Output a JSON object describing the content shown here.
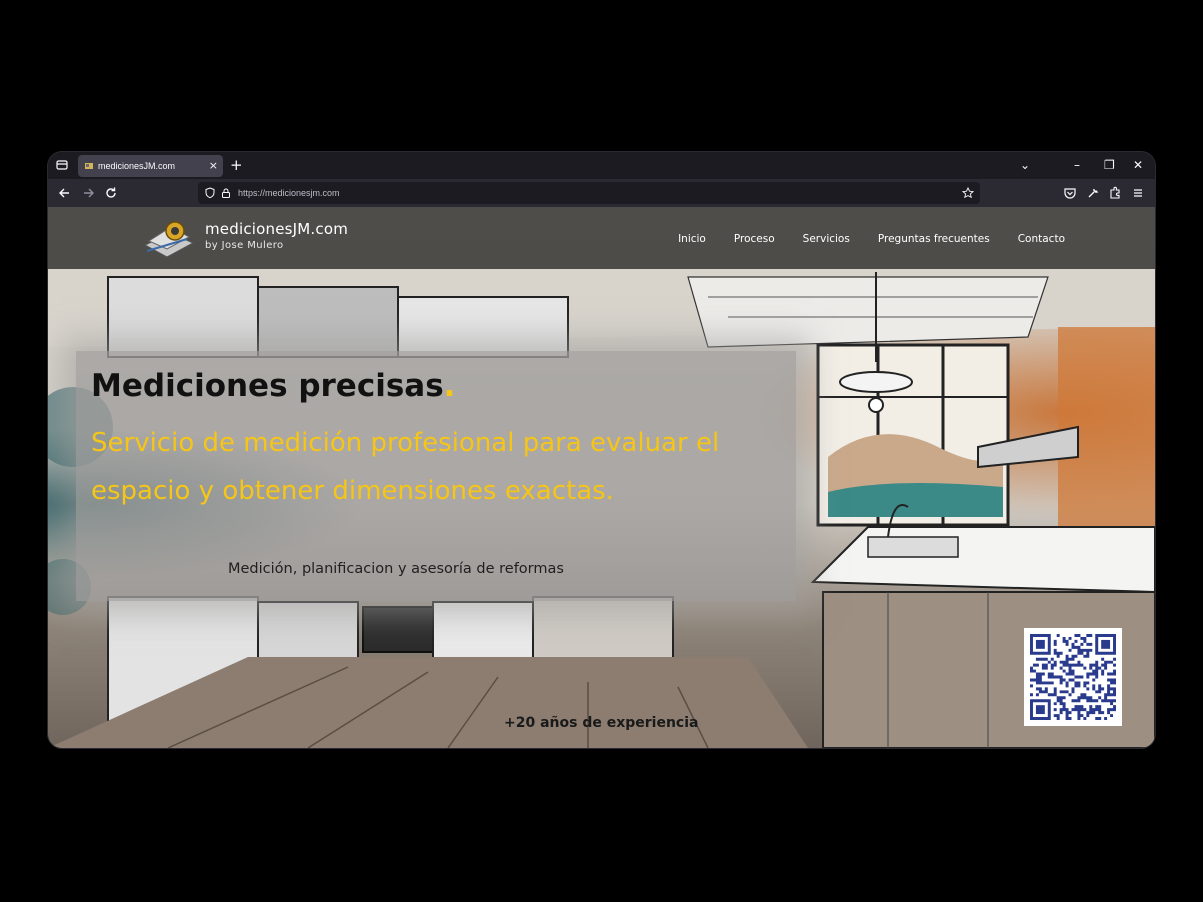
{
  "browser": {
    "tab_title": "medicionesJM.com",
    "tab_close": "×",
    "new_tab": "+",
    "url": "https://medicionesjm.com",
    "window_controls": {
      "dropdown": "⌄",
      "minimize": "–",
      "restore": "❐",
      "close": "✕"
    },
    "accent": "#2b2a33"
  },
  "site": {
    "logo": {
      "title": "medicionesJM.com",
      "subtitle": "by Jose Mulero"
    },
    "nav": [
      "Inicio",
      "Proceso",
      "Servicios",
      "Preguntas frecuentes",
      "Contacto"
    ],
    "hero": {
      "title": "Mediciones precisas",
      "title_dot": ".",
      "subtitle": "Servicio de medición profesional para evaluar el espacio y obtener dimensiones exactas.",
      "tagline": "Medición, planificacion y asesoría de reformas"
    },
    "experience": "+20 años de experiencia",
    "colors": {
      "accent_yellow": "#f5c518",
      "header_bg": "#302e2c"
    }
  }
}
